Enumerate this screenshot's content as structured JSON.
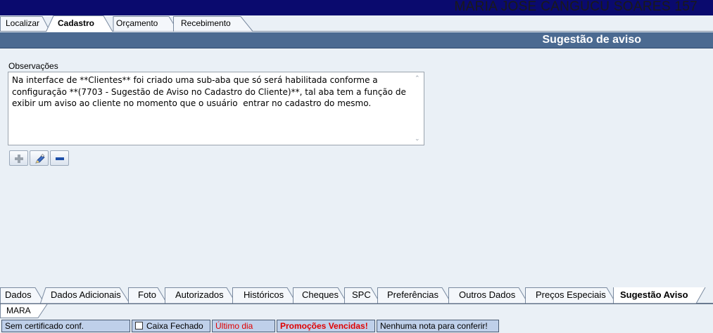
{
  "header": {
    "user_name": "MARIA JOSE CANGUCU SOARES 157"
  },
  "top_tabs": [
    {
      "label": "Localizar",
      "active": false
    },
    {
      "label": "Cadastro",
      "active": true
    },
    {
      "label": "Orçamento",
      "active": false
    },
    {
      "label": "Recebimento",
      "active": false
    }
  ],
  "section": {
    "title": "Sugestão de aviso"
  },
  "observacoes": {
    "label": "Observações",
    "text": "Na interface de **Clientes** foi criado uma sub-aba que só será habilitada conforme a\nconfiguração **(7703 - Sugestão de Aviso no Cadastro do Cliente)**, tal aba tem a função de\nexibir um aviso ao cliente no momento que o usuário  entrar no cadastro do mesmo."
  },
  "toolbar": {
    "add_icon": "plus-icon",
    "edit_icon": "pencil-icon",
    "remove_icon": "minus-icon"
  },
  "bottom_tabs": [
    {
      "label": "Dados",
      "active": false
    },
    {
      "label": "Dados Adicionais",
      "active": false
    },
    {
      "label": "Foto",
      "active": false
    },
    {
      "label": "Autorizados",
      "active": false
    },
    {
      "label": "Históricos",
      "active": false
    },
    {
      "label": "Cheques",
      "active": false
    },
    {
      "label": "SPC",
      "active": false
    },
    {
      "label": "Preferências",
      "active": false
    },
    {
      "label": "Outros Dados",
      "active": false
    },
    {
      "label": "Preços Especiais",
      "active": false
    },
    {
      "label": "Sugestão Aviso",
      "active": true
    }
  ],
  "user_tab": {
    "label": "MARA"
  },
  "statusbar": {
    "certificado": "Sem certificado conf.",
    "caixa": "Caixa Fechado",
    "ultimo_dia": "Último dia",
    "promocoes": "Promoções Vencidas!",
    "nota": "Nenhuma nota para conferir!"
  },
  "colors": {
    "banner": "#0a0a6e",
    "section_bar": "#4b6a91",
    "status_blue": "#bfd0ea",
    "alert_red": "#e00000"
  }
}
